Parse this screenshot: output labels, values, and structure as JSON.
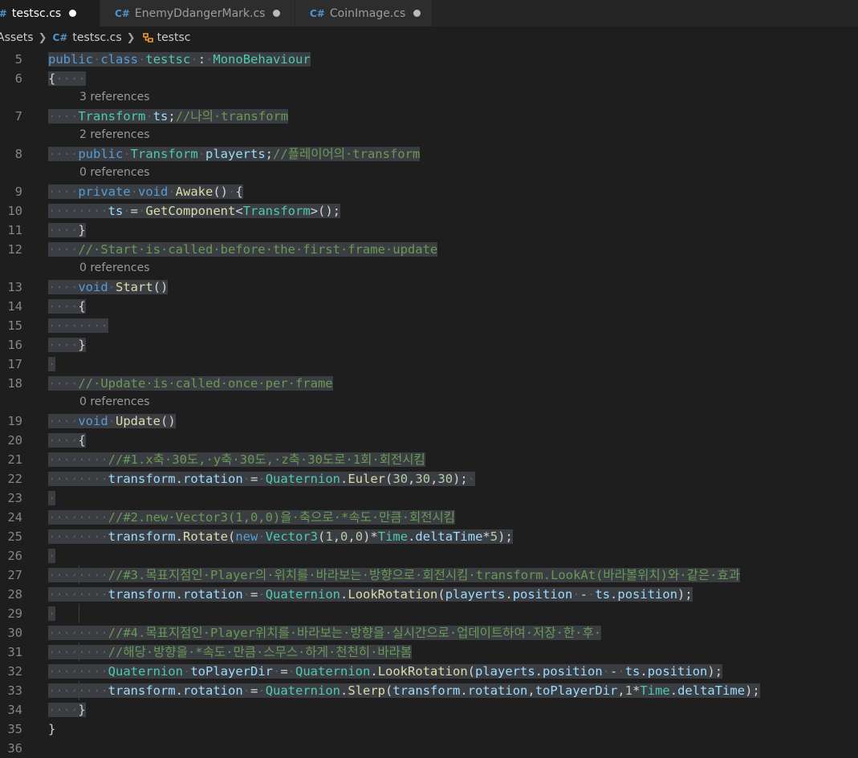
{
  "tabs": [
    {
      "label": "testsc.cs",
      "icon": "csharp-file-icon",
      "active": true,
      "dirty": true
    },
    {
      "label": "EnemyDdangerMark.cs",
      "icon": "csharp-file-icon",
      "active": false,
      "dirty": true
    },
    {
      "label": "CoinImage.cs",
      "icon": "csharp-file-icon",
      "active": false,
      "dirty": true
    }
  ],
  "breadcrumb": {
    "folder": "Assets",
    "file": "testsc.cs",
    "symbol": "testsc"
  },
  "colors": {
    "background": "#1e1e1e",
    "selection": "#3a3d41",
    "keyword": "#569cd6",
    "type": "#4ec9b0",
    "function": "#dcdcaa",
    "variable": "#9cdcfe",
    "comment": "#6a9955",
    "number": "#b5cea8"
  },
  "code_lines": [
    {
      "num": "5",
      "ref": null,
      "tokens": [
        [
          "kw",
          "public"
        ],
        [
          "ws",
          "·"
        ],
        [
          "kw",
          "class"
        ],
        [
          "ws",
          "·"
        ],
        [
          "ty",
          "testsc"
        ],
        [
          "ws",
          "·"
        ],
        [
          "pl",
          ":"
        ],
        [
          "ws",
          "·"
        ],
        [
          "ty",
          "MonoBehaviour"
        ]
      ]
    },
    {
      "num": "6",
      "ref": null,
      "tokens": [
        [
          "pl",
          "{"
        ],
        [
          "ws",
          "····"
        ]
      ]
    },
    {
      "num": "7",
      "ref": "3 references",
      "tokens": [
        [
          "ws",
          "····"
        ],
        [
          "ty",
          "Transform"
        ],
        [
          "ws",
          "·"
        ],
        [
          "vr",
          "ts"
        ],
        [
          "pl",
          ";"
        ],
        [
          "cm",
          "//나의·transform"
        ]
      ]
    },
    {
      "num": "8",
      "ref": "2 references",
      "tokens": [
        [
          "ws",
          "····"
        ],
        [
          "kw",
          "public"
        ],
        [
          "ws",
          "·"
        ],
        [
          "ty",
          "Transform"
        ],
        [
          "ws",
          "·"
        ],
        [
          "vr",
          "playerts"
        ],
        [
          "pl",
          ";"
        ],
        [
          "cm",
          "//플레이어의·transform"
        ]
      ]
    },
    {
      "num": "9",
      "ref": "0 references",
      "tokens": [
        [
          "ws",
          "····"
        ],
        [
          "kw",
          "private"
        ],
        [
          "ws",
          "·"
        ],
        [
          "kw",
          "void"
        ],
        [
          "ws",
          "·"
        ],
        [
          "fn",
          "Awake"
        ],
        [
          "pl",
          "()"
        ],
        [
          "ws",
          "·"
        ],
        [
          "pl",
          "{"
        ]
      ]
    },
    {
      "num": "10",
      "ref": null,
      "tokens": [
        [
          "ws",
          "········"
        ],
        [
          "vr",
          "ts"
        ],
        [
          "ws",
          "·"
        ],
        [
          "pl",
          "="
        ],
        [
          "ws",
          "·"
        ],
        [
          "fn",
          "GetComponent"
        ],
        [
          "pl",
          "<"
        ],
        [
          "ty",
          "Transform"
        ],
        [
          "pl",
          ">();"
        ]
      ]
    },
    {
      "num": "11",
      "ref": null,
      "tokens": [
        [
          "ws",
          "····"
        ],
        [
          "pl",
          "}"
        ]
      ]
    },
    {
      "num": "12",
      "ref": null,
      "tokens": [
        [
          "ws",
          "····"
        ],
        [
          "cm",
          "//·Start·is·called·before·the·first·frame·update"
        ]
      ]
    },
    {
      "num": "13",
      "ref": "0 references",
      "tokens": [
        [
          "ws",
          "····"
        ],
        [
          "kw",
          "void"
        ],
        [
          "ws",
          "·"
        ],
        [
          "fn",
          "Start"
        ],
        [
          "pl",
          "()"
        ]
      ]
    },
    {
      "num": "14",
      "ref": null,
      "tokens": [
        [
          "ws",
          "····"
        ],
        [
          "pl",
          "{"
        ]
      ]
    },
    {
      "num": "15",
      "ref": null,
      "tokens": [
        [
          "ws",
          "········"
        ]
      ]
    },
    {
      "num": "16",
      "ref": null,
      "tokens": [
        [
          "ws",
          "····"
        ],
        [
          "pl",
          "}"
        ]
      ]
    },
    {
      "num": "17",
      "ref": null,
      "tokens": [
        [
          "ws",
          "·"
        ]
      ]
    },
    {
      "num": "18",
      "ref": null,
      "tokens": [
        [
          "ws",
          "····"
        ],
        [
          "cm",
          "//·Update·is·called·once·per·frame"
        ]
      ]
    },
    {
      "num": "19",
      "ref": "0 references",
      "tokens": [
        [
          "ws",
          "····"
        ],
        [
          "kw",
          "void"
        ],
        [
          "ws",
          "·"
        ],
        [
          "fn",
          "Update"
        ],
        [
          "pl",
          "()"
        ]
      ]
    },
    {
      "num": "20",
      "ref": null,
      "tokens": [
        [
          "ws",
          "····"
        ],
        [
          "pl",
          "{"
        ]
      ]
    },
    {
      "num": "21",
      "ref": null,
      "tokens": [
        [
          "ws",
          "········"
        ],
        [
          "cm",
          "//#1.x축·30도,·y축·30도,·z축·30도로·1회·회전시킴"
        ]
      ]
    },
    {
      "num": "22",
      "ref": null,
      "tokens": [
        [
          "ws",
          "········"
        ],
        [
          "vr",
          "transform"
        ],
        [
          "pl",
          "."
        ],
        [
          "vr",
          "rotation"
        ],
        [
          "ws",
          "·"
        ],
        [
          "pl",
          "="
        ],
        [
          "ws",
          "·"
        ],
        [
          "ty",
          "Quaternion"
        ],
        [
          "pl",
          "."
        ],
        [
          "fn",
          "Euler"
        ],
        [
          "pl",
          "("
        ],
        [
          "nm",
          "30"
        ],
        [
          "pl",
          ","
        ],
        [
          "nm",
          "30"
        ],
        [
          "pl",
          ","
        ],
        [
          "nm",
          "30"
        ],
        [
          "pl",
          ");"
        ],
        [
          "ws",
          "·"
        ]
      ]
    },
    {
      "num": "23",
      "ref": null,
      "tokens": [
        [
          "ws",
          "·"
        ]
      ]
    },
    {
      "num": "24",
      "ref": null,
      "tokens": [
        [
          "ws",
          "········"
        ],
        [
          "cm",
          "//#2.new·Vector3(1,0,0)을·축으로·*속도·만큼·회전시킴"
        ]
      ]
    },
    {
      "num": "25",
      "ref": null,
      "tokens": [
        [
          "ws",
          "········"
        ],
        [
          "vr",
          "transform"
        ],
        [
          "pl",
          "."
        ],
        [
          "fn",
          "Rotate"
        ],
        [
          "pl",
          "("
        ],
        [
          "kw",
          "new"
        ],
        [
          "ws",
          "·"
        ],
        [
          "ty",
          "Vector3"
        ],
        [
          "pl",
          "("
        ],
        [
          "nm",
          "1"
        ],
        [
          "pl",
          ","
        ],
        [
          "nm",
          "0"
        ],
        [
          "pl",
          ","
        ],
        [
          "nm",
          "0"
        ],
        [
          "pl",
          ")*"
        ],
        [
          "ty",
          "Time"
        ],
        [
          "pl",
          "."
        ],
        [
          "vr",
          "deltaTime"
        ],
        [
          "pl",
          "*"
        ],
        [
          "nm",
          "5"
        ],
        [
          "pl",
          ");"
        ]
      ]
    },
    {
      "num": "26",
      "ref": null,
      "tokens": [
        [
          "ws",
          "·"
        ]
      ]
    },
    {
      "num": "27",
      "ref": null,
      "tokens": [
        [
          "ws",
          "········"
        ],
        [
          "cm",
          "//#3.목표지점인·Player의·위치를·바라보는·방향으로·회전시킴·transform.LookAt(바라볼위치)와·같은·효과"
        ]
      ]
    },
    {
      "num": "28",
      "ref": null,
      "tokens": [
        [
          "ws",
          "········"
        ],
        [
          "vr",
          "transform"
        ],
        [
          "pl",
          "."
        ],
        [
          "vr",
          "rotation"
        ],
        [
          "ws",
          "·"
        ],
        [
          "pl",
          "="
        ],
        [
          "ws",
          "·"
        ],
        [
          "ty",
          "Quaternion"
        ],
        [
          "pl",
          "."
        ],
        [
          "fn",
          "LookRotation"
        ],
        [
          "pl",
          "("
        ],
        [
          "vr",
          "playerts"
        ],
        [
          "pl",
          "."
        ],
        [
          "vr",
          "position"
        ],
        [
          "ws",
          "·"
        ],
        [
          "pl",
          "-"
        ],
        [
          "ws",
          "·"
        ],
        [
          "vr",
          "ts"
        ],
        [
          "pl",
          "."
        ],
        [
          "vr",
          "position"
        ],
        [
          "pl",
          ");"
        ]
      ]
    },
    {
      "num": "29",
      "ref": null,
      "tokens": [
        [
          "ws",
          "·"
        ]
      ]
    },
    {
      "num": "30",
      "ref": null,
      "tokens": [
        [
          "ws",
          "········"
        ],
        [
          "cm",
          "//#4.목표지점인·Player위치를·바라보는·방향을·실시간으로·업데이트하여·저장·한·후·"
        ]
      ]
    },
    {
      "num": "31",
      "ref": null,
      "tokens": [
        [
          "ws",
          "········"
        ],
        [
          "cm",
          "//해당·방향을·*속도·만큼·스무스·하게·천천히·바라봄"
        ]
      ]
    },
    {
      "num": "32",
      "ref": null,
      "tokens": [
        [
          "ws",
          "········"
        ],
        [
          "ty",
          "Quaternion"
        ],
        [
          "ws",
          "·"
        ],
        [
          "vr",
          "toPlayerDir"
        ],
        [
          "ws",
          "·"
        ],
        [
          "pl",
          "="
        ],
        [
          "ws",
          "·"
        ],
        [
          "ty",
          "Quaternion"
        ],
        [
          "pl",
          "."
        ],
        [
          "fn",
          "LookRotation"
        ],
        [
          "pl",
          "("
        ],
        [
          "vr",
          "playerts"
        ],
        [
          "pl",
          "."
        ],
        [
          "vr",
          "position"
        ],
        [
          "ws",
          "·"
        ],
        [
          "pl",
          "-"
        ],
        [
          "ws",
          "·"
        ],
        [
          "vr",
          "ts"
        ],
        [
          "pl",
          "."
        ],
        [
          "vr",
          "position"
        ],
        [
          "pl",
          ");"
        ]
      ]
    },
    {
      "num": "33",
      "ref": null,
      "tokens": [
        [
          "ws",
          "········"
        ],
        [
          "vr",
          "transform"
        ],
        [
          "pl",
          "."
        ],
        [
          "vr",
          "rotation"
        ],
        [
          "ws",
          "·"
        ],
        [
          "pl",
          "="
        ],
        [
          "ws",
          "·"
        ],
        [
          "ty",
          "Quaternion"
        ],
        [
          "pl",
          "."
        ],
        [
          "fn",
          "Slerp"
        ],
        [
          "pl",
          "("
        ],
        [
          "vr",
          "transform"
        ],
        [
          "pl",
          "."
        ],
        [
          "vr",
          "rotation"
        ],
        [
          "pl",
          ","
        ],
        [
          "vr",
          "toPlayerDir"
        ],
        [
          "pl",
          ","
        ],
        [
          "nm",
          "1"
        ],
        [
          "pl",
          "*"
        ],
        [
          "ty",
          "Time"
        ],
        [
          "pl",
          "."
        ],
        [
          "vr",
          "deltaTime"
        ],
        [
          "pl",
          ");"
        ]
      ]
    },
    {
      "num": "34",
      "ref": null,
      "tokens": [
        [
          "ws",
          "····"
        ],
        [
          "pl",
          "}"
        ]
      ]
    },
    {
      "num": "35",
      "ref": null,
      "tokens": [
        [
          "pl",
          "}"
        ]
      ]
    },
    {
      "num": "36",
      "ref": null,
      "tokens": []
    }
  ]
}
